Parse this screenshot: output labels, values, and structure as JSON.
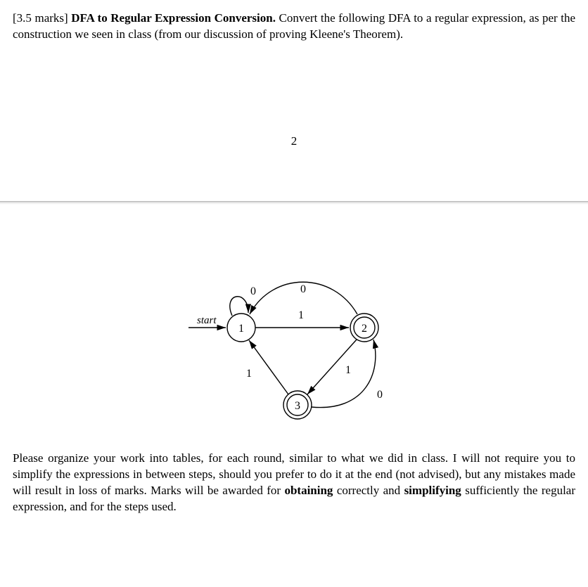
{
  "question": {
    "marks": "[3.5 marks]",
    "title": "DFA to Regular Expression Conversion.",
    "prompt_part1": " Convert the following DFA to a regular expression, as per the construction we seen in class (from our discussion of proving Kleene's Theorem)."
  },
  "page_number": "2",
  "diagram": {
    "start_label": "start",
    "state_1": "1",
    "state_2": "2",
    "state_3": "3",
    "edge_1_loop": "0",
    "edge_2_to_1": "0",
    "edge_1_to_2": "1",
    "edge_2_to_3": "1",
    "edge_3_to_1": "1",
    "edge_3_to_2": "0"
  },
  "instructions": {
    "text_part1": "Please organize your work into tables, for each round, similar to what we did in class. I will not require you to simplify the expressions in between steps, should you prefer to do it at the end (not advised), but any mistakes made will result in loss of marks. Marks will be awarded for ",
    "bold1": "obtaining",
    "text_part2": " correctly and ",
    "bold2": "simplifying",
    "text_part3": " sufficiently the regular expression, and for the steps used."
  }
}
